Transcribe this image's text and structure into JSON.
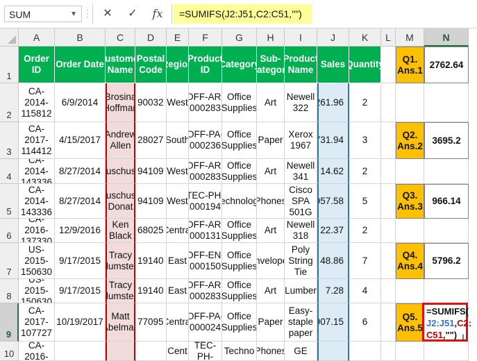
{
  "formula_bar": {
    "name_box": "SUM",
    "cancel_glyph": "✕",
    "enter_glyph": "✓",
    "fx_label": "fx",
    "formula": "=SUMIFS(J2:J51,C2:C51,\"\")"
  },
  "columns": [
    "A",
    "B",
    "C",
    "D",
    "E",
    "F",
    "G",
    "H",
    "I",
    "J",
    "K",
    "L",
    "M",
    "N"
  ],
  "rows": [
    "1",
    "2",
    "3",
    "4",
    "5",
    "6",
    "7",
    "8",
    "9",
    "10"
  ],
  "headers": [
    "Order ID",
    "Order Date",
    "Customer Name",
    "Postal Code",
    "Region",
    "Product ID",
    "Category",
    "Sub-Category",
    "Product Name",
    "Sales",
    "Quantity"
  ],
  "data_rows": [
    [
      "CA-2014-115812",
      "6/9/2014",
      "Brosina Hoffman",
      "90032",
      "West",
      "OFF-AR-10002833",
      "Office Supplies",
      "Art",
      "Newell 322",
      "261.96",
      "2"
    ],
    [
      "CA-2017-114412",
      "4/15/2017",
      "Andrew Allen",
      "28027",
      "South",
      "OFF-PA-10002365",
      "Office Supplies",
      "Paper",
      "Xerox 1967",
      "731.94",
      "3"
    ],
    [
      "CA-2014-143336",
      "8/27/2014",
      "Zuschuss",
      "94109",
      "West",
      "OFF-AR-10002833",
      "Office Supplies",
      "Art",
      "Newell 341",
      "14.62",
      "2"
    ],
    [
      "CA-2014-143336",
      "8/27/2014",
      "Zuschuss Donat",
      "94109",
      "West",
      "TEC-PH-10001949",
      "Technology",
      "Phones",
      "Cisco SPA 501G",
      "957.58",
      "5"
    ],
    [
      "CA-2016-137330",
      "12/9/2016",
      "Ken Black",
      "68025",
      "Central",
      "OFF-AR-10001318",
      "Office Supplies",
      "Art",
      "Newell 318",
      "22.37",
      "2"
    ],
    [
      "US-2015-150630",
      "9/17/2015",
      "Tracy Blumstein",
      "19140",
      "East",
      "OFF-EN-10001509",
      "Office Supplies",
      "Envelopes",
      "Poly String Tie",
      "48.86",
      "7"
    ],
    [
      "US-2015-150630",
      "9/17/2015",
      "Tracy Blumstein",
      "19140",
      "East",
      "OFF-AR-10002833",
      "Office Supplies",
      "Art",
      "Lumber",
      "7.28",
      "4"
    ],
    [
      "CA-2017-107727",
      "10/19/2017",
      "Matt Abelman",
      "77095",
      "Central",
      "OFF-PA-10000249",
      "Office Supplies",
      "Paper",
      "Easy-staple paper",
      "907.15",
      "6"
    ],
    [
      "CA-2016-",
      "",
      "",
      "",
      "Cent",
      "TEC-PH-",
      "Techno",
      "Phones",
      "GE",
      "",
      ""
    ]
  ],
  "answers": [
    {
      "label": "Q1. Ans.1",
      "value": "2762.64"
    },
    {
      "label": "Q2. Ans.2",
      "value": "3695.2"
    },
    {
      "label": "Q3. Ans.3",
      "value": "966.14"
    },
    {
      "label": "Q4. Ans.4",
      "value": "5796.2"
    },
    {
      "label": "Q5. Ans.5"
    }
  ],
  "edit_cell": {
    "line1": "=SUMIFS(",
    "ref1": "J2:J51",
    "comma1": ",",
    "ref2": "C2:",
    "ref2b": "C51",
    "tail": ",\"\")"
  }
}
